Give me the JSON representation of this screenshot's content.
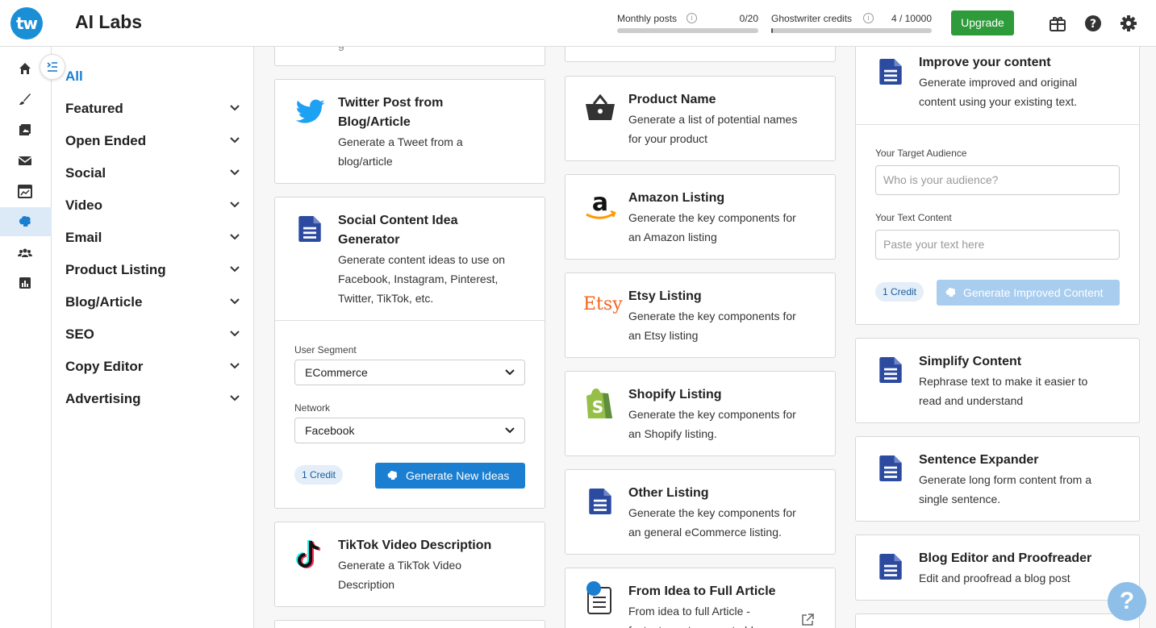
{
  "header": {
    "logo_text": "tw",
    "title": "AI Labs",
    "monthly_posts": {
      "label": "Monthly posts",
      "value": "0/20",
      "fraction": 0.0
    },
    "ghostwriter": {
      "label": "Ghostwriter credits",
      "value": "4 / 10000",
      "fraction": 0.0004
    },
    "upgrade_label": "Upgrade",
    "icons": [
      "gift-icon",
      "help-icon",
      "gear-icon"
    ]
  },
  "rail": {
    "items": [
      "home-icon",
      "brush-icon",
      "image-icon",
      "mail-icon",
      "calendar-chart-icon",
      "brain-icon",
      "users-icon",
      "analytics-icon"
    ],
    "active_index": 5
  },
  "categories": {
    "all_label": "All",
    "items": [
      "Featured",
      "Open Ended",
      "Social",
      "Video",
      "Email",
      "Product Listing",
      "Blog/Article",
      "SEO",
      "Copy Editor",
      "Advertising"
    ]
  },
  "col1": {
    "twitter": {
      "title_l1": "Twitter Post from",
      "title_l2": "Blog/Article",
      "desc_l1": "Generate a Tweet from a",
      "desc_l2": "blog/article"
    },
    "social": {
      "title_l1": "Social Content Idea",
      "title_l2": "Generator",
      "desc_l1": "Generate content ideas to use on",
      "desc_l2": "Facebook, Instagram, Pinterest,",
      "desc_l3": "Twitter, TikTok, etc.",
      "segment_label": "User Segment",
      "segment_value": "ECommerce",
      "network_label": "Network",
      "network_value": "Facebook",
      "credit": "1 Credit",
      "button": "Generate New Ideas"
    },
    "tiktok": {
      "title": "TikTok Video Description",
      "desc_l1": "Generate a TikTok Video",
      "desc_l2": "Description"
    }
  },
  "col2": {
    "product_name": {
      "title": "Product Name",
      "desc_l1": "Generate a list of potential names",
      "desc_l2": "for your product"
    },
    "amazon": {
      "title": "Amazon Listing",
      "desc_l1": "Generate the key components for",
      "desc_l2": "an Amazon listing"
    },
    "etsy": {
      "logo": "Etsy",
      "title": "Etsy Listing",
      "desc_l1": "Generate the key components for",
      "desc_l2": "an Etsy listing"
    },
    "shopify": {
      "title": "Shopify Listing",
      "desc_l1": "Generate the key components for",
      "desc_l2": "an Shopify listing."
    },
    "other": {
      "title": "Other Listing",
      "desc_l1": "Generate the key components for",
      "desc_l2": "an general eCommerce listing."
    },
    "idea": {
      "title": "From Idea to Full Article",
      "desc_l1": "From idea to full Article -",
      "desc_l2": "fastest way to a create blog"
    }
  },
  "col3": {
    "improve": {
      "title": "Improve your content",
      "desc_l1": "Generate improved and original",
      "desc_l2": "content using your existing text.",
      "audience_label": "Your Target Audience",
      "audience_placeholder": "Who is your audience?",
      "text_label": "Your Text Content",
      "text_placeholder": "Paste your text here",
      "credit": "1 Credit",
      "button": "Generate Improved Content"
    },
    "simplify": {
      "title": "Simplify Content",
      "desc_l1": "Rephrase text to make it easier to",
      "desc_l2": "read and understand"
    },
    "expander": {
      "title": "Sentence Expander",
      "desc_l1": "Generate long form content from a",
      "desc_l2": "single sentence."
    },
    "blog_editor": {
      "title": "Blog Editor and Proofreader",
      "desc_l1": "Edit and proofread a blog post"
    }
  },
  "help_fab": "?",
  "colors": {
    "accent": "#1a7ed1",
    "upgrade": "#2e9b3a",
    "doc_icon": "#2b4aa0",
    "twitter": "#1da1f2",
    "shopify": "#95bf47",
    "etsy": "#f1641e"
  }
}
